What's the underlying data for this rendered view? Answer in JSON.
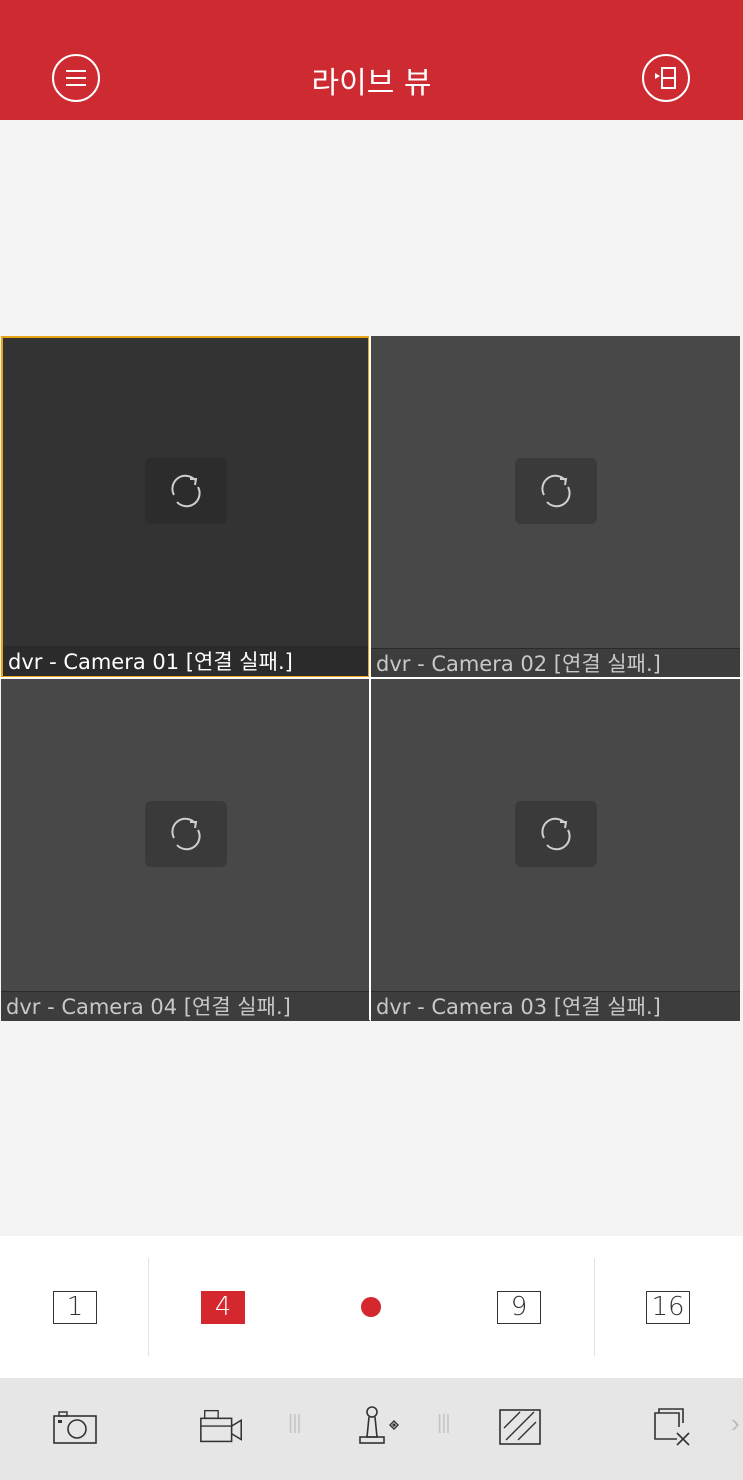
{
  "header": {
    "title": "라이브 뷰",
    "menu_icon": "menu-icon",
    "device_list_icon": "device-list-icon"
  },
  "cameras": [
    {
      "label": "dvr - Camera 01 [연결 실패.]",
      "selected": true
    },
    {
      "label": "dvr - Camera 02 [연결 실패.]",
      "selected": false
    },
    {
      "label": "dvr - Camera 04 [연결 실패.]",
      "selected": false
    },
    {
      "label": "dvr - Camera 03 [연결 실패.]",
      "selected": false
    }
  ],
  "layouts": {
    "one": "1",
    "four": "4",
    "nine": "9",
    "sixteen": "16",
    "selected": "4"
  },
  "toolbar": {
    "tools": [
      "screenshot-icon",
      "record-video-icon",
      "ptz-joystick-icon",
      "image-quality-icon",
      "close-all-icon"
    ],
    "more": "›"
  },
  "colors": {
    "brand_red": "#cd2a31",
    "selected_border": "#e8a417"
  }
}
